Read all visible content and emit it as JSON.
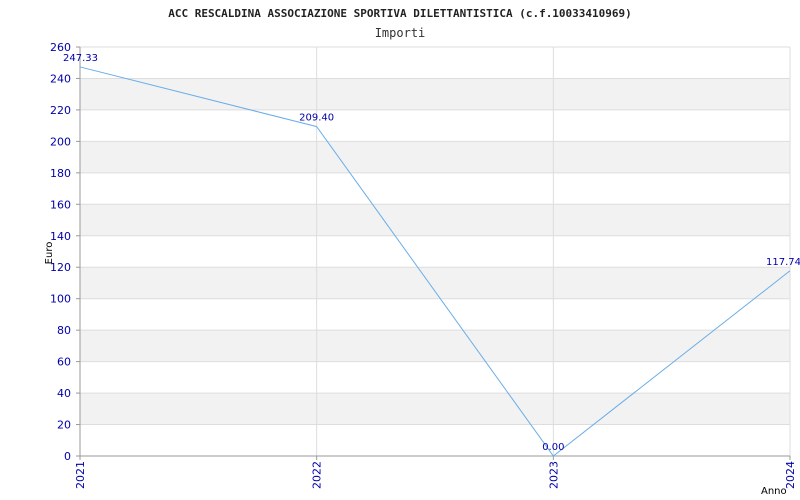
{
  "chart_data": {
    "type": "line",
    "title": "ACC RESCALDINA ASSOCIAZIONE SPORTIVA DILETTANTISTICA (c.f.10033410969)",
    "subtitle": "Importi",
    "xlabel": "Anno",
    "ylabel": "Euro",
    "categories": [
      "2021",
      "2022",
      "2023",
      "2024"
    ],
    "series": [
      {
        "values": [
          247.33,
          209.4,
          0.0,
          117.74
        ]
      }
    ],
    "data_labels": [
      "247.33",
      "209.40",
      "0.00",
      "117.74"
    ],
    "yticks": [
      0,
      20,
      40,
      60,
      80,
      100,
      120,
      140,
      160,
      180,
      200,
      220,
      240,
      260
    ],
    "ylim": [
      0,
      260
    ],
    "grid": true,
    "colors": {
      "line": "#6aaee8",
      "band": "#f2f2f2",
      "tick_text": "#0000aa",
      "grid": "#dddddd"
    }
  }
}
